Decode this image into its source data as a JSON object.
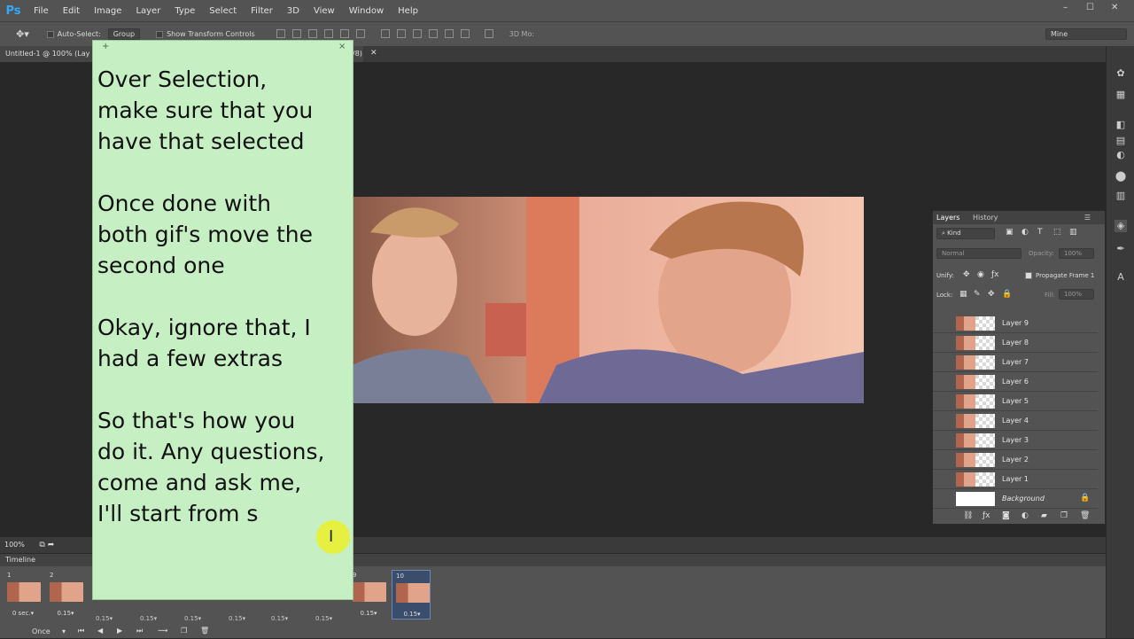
{
  "app": {
    "logo": "Ps",
    "menu": [
      "File",
      "Edit",
      "Image",
      "Layer",
      "Type",
      "Select",
      "Filter",
      "3D",
      "View",
      "Window",
      "Help"
    ],
    "window_controls": [
      "–",
      "☐",
      "✕"
    ]
  },
  "options_bar": {
    "auto_select_label": "Auto-Select:",
    "auto_select_value": "Group",
    "show_transform_label": "Show Transform Controls",
    "mode_3d_label": "3D Mo:",
    "workspace": "Mine"
  },
  "document": {
    "tab_title": "Untitled-1 @ 100% (Lay",
    "tab_suffix": "/8)",
    "zoom": "100%"
  },
  "note": {
    "text": "Over Selection,\nmake sure that you\nhave that selected\n\nOnce done with\nboth gif's move the\nsecond one\n\nOkay, ignore that, I\nhad a few extras\n\nSo that's how you\ndo it. Any questions,\ncome and ask me,\nI'll start from s",
    "color": "#c6f0c4"
  },
  "timeline": {
    "title": "Timeline",
    "frames": [
      {
        "num": "1",
        "dur": "0 sec.▾"
      },
      {
        "num": "2",
        "dur": "0.15▾"
      },
      {
        "num": "9",
        "dur": "0.15▾"
      },
      {
        "num": "10",
        "dur": "0.15▾"
      }
    ],
    "hidden_durations": [
      "0.15▾",
      "0.15▾",
      "0.15▾",
      "0.15▾",
      "0.15▾",
      "0.15▾"
    ],
    "loop_option": "Once"
  },
  "layers_panel": {
    "tabs": [
      "Layers",
      "History"
    ],
    "filter_kind": "Kind",
    "blend_mode": "Normal",
    "opacity_label": "Opacity:",
    "opacity_value": "100%",
    "unify_label": "Unify:",
    "propagate_label": "Propagate Frame 1",
    "lock_label": "Lock:",
    "fill_label": "Fill:",
    "fill_value": "100%",
    "layers": [
      "Layer 9",
      "Layer 8",
      "Layer 7",
      "Layer 6",
      "Layer 5",
      "Layer 4",
      "Layer 3",
      "Layer 2",
      "Layer 1"
    ],
    "background_layer": "Background"
  },
  "colors": {
    "ui_panel": "#535353",
    "canvas_bg": "#282828",
    "accent_blue": "#31a8ff",
    "note_green": "#c6f0c4",
    "cursor_highlight": "#f0f014"
  }
}
